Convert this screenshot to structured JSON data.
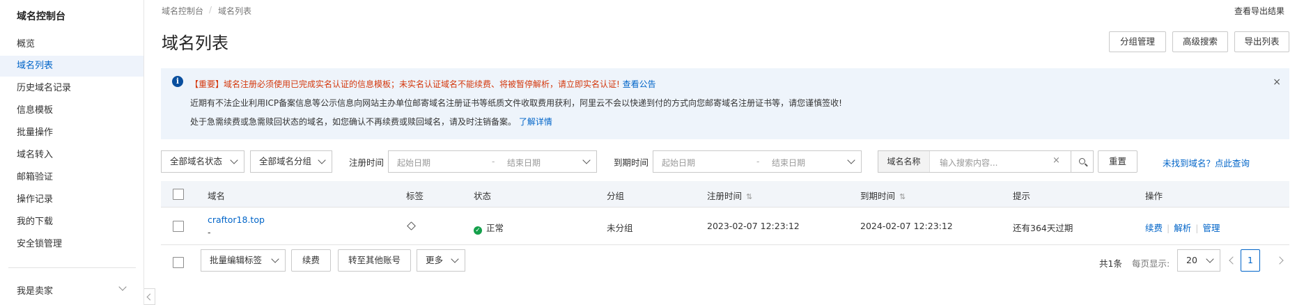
{
  "sidebar": {
    "title": "域名控制台",
    "items": [
      {
        "label": "概览"
      },
      {
        "label": "域名列表"
      },
      {
        "label": "历史域名记录"
      },
      {
        "label": "信息模板"
      },
      {
        "label": "批量操作"
      },
      {
        "label": "域名转入"
      },
      {
        "label": "邮箱验证"
      },
      {
        "label": "操作记录"
      },
      {
        "label": "我的下载"
      },
      {
        "label": "安全锁管理"
      }
    ],
    "seller_label": "我是卖家"
  },
  "breadcrumb": {
    "root": "域名控制台",
    "sep": "/",
    "current": "域名列表"
  },
  "header": {
    "view_export": "查看导出结果",
    "title": "域名列表",
    "buttons": {
      "group_manage": "分组管理",
      "advanced_search": "高级搜索",
      "export_list": "导出列表"
    }
  },
  "notice": {
    "line1_red": "【重要】域名注册必须使用已完成实名认证的信息模板；未实名认证域名不能续费、将被暂停解析，请立即实名认证!",
    "line1_link": "查看公告",
    "line2": "近期有不法企业利用ICP备案信息等公示信息向网站主办单位邮寄域名注册证书等纸质文件收取费用获利，阿里云不会以快递到付的方式向您邮寄域名注册证书等，请您谨慎签收!",
    "line3": "处于急需续费或急需赎回状态的域名，如您确认不再续费或赎回域名，请及时注销备案。",
    "line3_link": "了解详情",
    "close": "×"
  },
  "filters": {
    "status_select": "全部域名状态",
    "group_select": "全部域名分组",
    "reg_label": "注册时间",
    "reg_start": "起始日期",
    "reg_end": "结束日期",
    "exp_label": "到期时间",
    "exp_start": "起始日期",
    "exp_end": "结束日期",
    "dash": "-",
    "search_label": "域名名称",
    "search_placeholder": "输入搜索内容...",
    "clear": "×",
    "reset": "重置",
    "not_found": "未找到域名？点此查询"
  },
  "table": {
    "headers": {
      "domain": "域名",
      "tag": "标签",
      "status": "状态",
      "group": "分组",
      "reg_time": "注册时间",
      "exp_time": "到期时间",
      "hint": "提示",
      "ops": "操作"
    },
    "sort_icon": "⇅",
    "rows": [
      {
        "domain": "craftor18.top",
        "sub": "-",
        "status": "正常",
        "group": "未分组",
        "reg_time": "2023-02-07 12:23:12",
        "exp_time": "2024-02-07 12:23:12",
        "hint": "还有364天过期",
        "ops": {
          "renew": "续费",
          "resolve": "解析",
          "manage": "管理",
          "sep": "|"
        }
      }
    ]
  },
  "footer": {
    "batch_tag": "批量编辑标签",
    "renew": "续费",
    "transfer": "转至其他账号",
    "more": "更多",
    "total": "共1条",
    "per_page_label": "每页显示:",
    "per_page": "20",
    "current_page": "1"
  },
  "colors": {
    "accent": "#0064c8",
    "notice_bg": "#eef4fb",
    "danger": "#d4380d",
    "ok": "#14a04b"
  }
}
